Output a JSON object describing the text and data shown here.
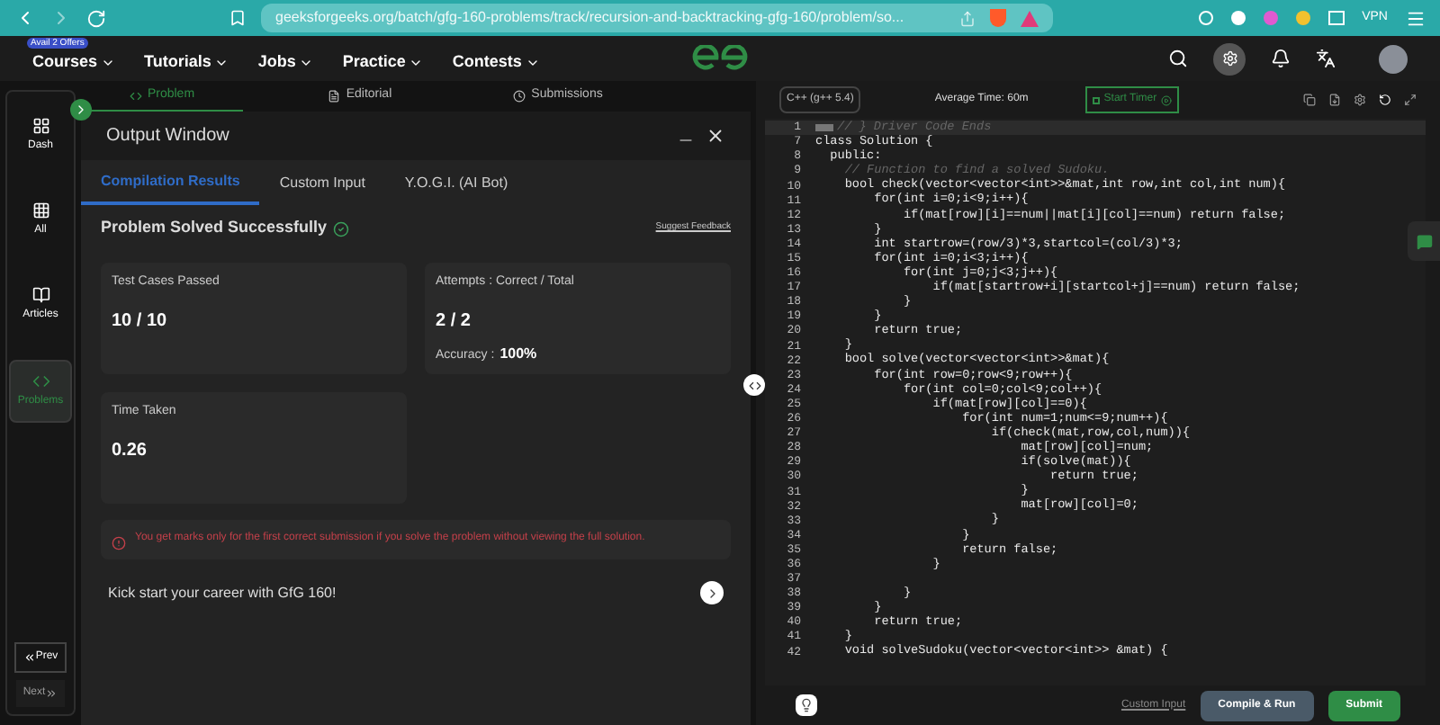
{
  "browser": {
    "url": "geeksforgeeks.org/batch/gfg-160-problems/track/recursion-and-backtracking-gfg-160/problem/so...",
    "vpn": "VPN"
  },
  "nav": {
    "offer_badge": "Avail 2 Offers",
    "menus": [
      "Courses",
      "Tutorials",
      "Jobs",
      "Practice",
      "Contests"
    ]
  },
  "sidebar": {
    "items": [
      {
        "label": "Dash",
        "selected": false
      },
      {
        "label": "All",
        "selected": false
      },
      {
        "label": "Articles",
        "selected": false
      },
      {
        "label": "Problems",
        "selected": true
      }
    ],
    "prev": "Prev",
    "next": "Next"
  },
  "problem_tabs": [
    {
      "label": "Problem",
      "selected": true
    },
    {
      "label": "Editorial",
      "selected": false
    },
    {
      "label": "Submissions",
      "selected": false
    }
  ],
  "output": {
    "title": "Output Window",
    "tabs": [
      {
        "label": "Compilation Results",
        "selected": true
      },
      {
        "label": "Custom Input",
        "selected": false
      },
      {
        "label": "Y.O.G.I. (AI Bot)",
        "selected": false
      }
    ],
    "status": "Problem Solved Successfully",
    "feedback": "Suggest Feedback",
    "test_cases": {
      "label": "Test Cases Passed",
      "value": "10 / 10"
    },
    "attempts": {
      "label": "Attempts : Correct / Total",
      "value": "2 / 2",
      "accuracy_label": "Accuracy :",
      "accuracy": "100%"
    },
    "time": {
      "label": "Time Taken",
      "value": "0.26"
    },
    "note": "You get marks only for the first correct submission if you solve the problem without viewing the full solution.",
    "promo": "Kick start your career with GfG 160!"
  },
  "editor": {
    "language": "C++ (g++ 5.4)",
    "average_time": "Average Time: 60m",
    "timer": "Start Timer",
    "lines": [
      {
        "n": "1",
        "code": "// } Driver Code Ends",
        "kind": "comment"
      },
      {
        "n": "7",
        "code": "class Solution {",
        "kind": "code"
      },
      {
        "n": "8",
        "code": "  public:",
        "kind": "code"
      },
      {
        "n": "9",
        "code": "    // Function to find a solved Sudoku.",
        "kind": "comment"
      },
      {
        "n": "10",
        "code": "    bool check(vector<vector<int>>&mat,int row,int col,int num){",
        "kind": "code"
      },
      {
        "n": "11",
        "code": "        for(int i=0;i<9;i++){",
        "kind": "code"
      },
      {
        "n": "12",
        "code": "            if(mat[row][i]==num||mat[i][col]==num) return false;",
        "kind": "code"
      },
      {
        "n": "13",
        "code": "        }",
        "kind": "code"
      },
      {
        "n": "14",
        "code": "        int startrow=(row/3)*3,startcol=(col/3)*3;",
        "kind": "code"
      },
      {
        "n": "15",
        "code": "        for(int i=0;i<3;i++){",
        "kind": "code"
      },
      {
        "n": "16",
        "code": "            for(int j=0;j<3;j++){",
        "kind": "code"
      },
      {
        "n": "17",
        "code": "                if(mat[startrow+i][startcol+j]==num) return false;",
        "kind": "code"
      },
      {
        "n": "18",
        "code": "            }",
        "kind": "code"
      },
      {
        "n": "19",
        "code": "        }",
        "kind": "code"
      },
      {
        "n": "20",
        "code": "        return true;",
        "kind": "code"
      },
      {
        "n": "21",
        "code": "    }",
        "kind": "code"
      },
      {
        "n": "22",
        "code": "    bool solve(vector<vector<int>>&mat){",
        "kind": "code"
      },
      {
        "n": "23",
        "code": "        for(int row=0;row<9;row++){",
        "kind": "code"
      },
      {
        "n": "24",
        "code": "            for(int col=0;col<9;col++){",
        "kind": "code"
      },
      {
        "n": "25",
        "code": "                if(mat[row][col]==0){",
        "kind": "code"
      },
      {
        "n": "26",
        "code": "                    for(int num=1;num<=9;num++){",
        "kind": "code"
      },
      {
        "n": "27",
        "code": "                        if(check(mat,row,col,num)){",
        "kind": "code"
      },
      {
        "n": "28",
        "code": "                            mat[row][col]=num;",
        "kind": "code"
      },
      {
        "n": "29",
        "code": "                            if(solve(mat)){",
        "kind": "code"
      },
      {
        "n": "30",
        "code": "                                return true;",
        "kind": "code"
      },
      {
        "n": "31",
        "code": "                            }",
        "kind": "code"
      },
      {
        "n": "32",
        "code": "                            mat[row][col]=0;",
        "kind": "code"
      },
      {
        "n": "33",
        "code": "                        }",
        "kind": "code"
      },
      {
        "n": "34",
        "code": "                    }",
        "kind": "code"
      },
      {
        "n": "35",
        "code": "                    return false;",
        "kind": "code"
      },
      {
        "n": "36",
        "code": "                }",
        "kind": "code"
      },
      {
        "n": "37"
      },
      {
        "n": "38",
        "code": "            }",
        "kind": "code"
      },
      {
        "n": "39",
        "code": "        }",
        "kind": "code"
      },
      {
        "n": "40",
        "code": "        return true;",
        "kind": "code"
      },
      {
        "n": "41",
        "code": "    }",
        "kind": "code"
      },
      {
        "n": "42",
        "code": "    void solveSudoku(vector<vector<int>> &mat) {",
        "kind": "code"
      }
    ],
    "custom_input": "Custom Input",
    "compile": "Compile & Run",
    "submit": "Submit"
  }
}
